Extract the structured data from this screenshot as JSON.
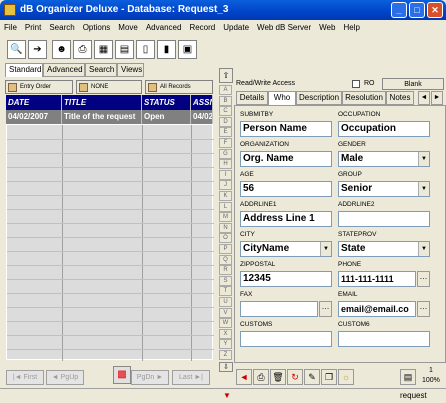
{
  "window": {
    "title": "dB Organizer Deluxe - Database: Request_3",
    "minimize": "_",
    "maximize": "□",
    "close": "✕"
  },
  "menu": [
    "File",
    "Print",
    "Search",
    "Options",
    "Move",
    "Advanced",
    "Record",
    "Update",
    "Web dB Server",
    "Web",
    "Help"
  ],
  "left_tabs": [
    "Standard",
    "Advanced",
    "Search",
    "Views"
  ],
  "left_toolbar": {
    "entry_order": "Entry Order",
    "none": "NONE",
    "all_records": "All Records"
  },
  "grid": {
    "columns": [
      "DATE",
      "TITLE",
      "STATUS",
      "ASSN"
    ],
    "rows": [
      [
        "04/02/2007",
        "Title of the request",
        "Open",
        "04/02/"
      ]
    ]
  },
  "nav": {
    "first": "|◄ First",
    "pgup": "◄ PgUp",
    "pgdn": "PgDn ►",
    "last": "Last ►|"
  },
  "letters": [
    "A",
    "B",
    "C",
    "D",
    "E",
    "F",
    "G",
    "H",
    "I",
    "J",
    "K",
    "L",
    "M",
    "N",
    "O",
    "P",
    "Q",
    "R",
    "S",
    "T",
    "U",
    "V",
    "W",
    "X",
    "Y",
    "Z"
  ],
  "right": {
    "access": "Read/Write Access",
    "ro": "RO",
    "blank": "Blank",
    "tabs": [
      "Details",
      "Who",
      "Description",
      "Resolution",
      "Notes"
    ]
  },
  "form": {
    "submitby_label": "SUBMITBY",
    "submitby": "Person Name",
    "occupation_label": "OCCUPATION",
    "occupation": "Occupation",
    "organization_label": "ORGANIZATION",
    "organization": "Org. Name",
    "gender_label": "GENDER",
    "gender": "Male",
    "age_label": "AGE",
    "age": "56",
    "group_label": "GROUP",
    "group": "Senior",
    "addrline1_label": "ADDRLINE1",
    "addrline1": "Address Line 1",
    "addrline2_label": "ADDRLINE2",
    "addrline2": "",
    "city_label": "CITY",
    "city": "CityName",
    "stateprov_label": "STATEPROV",
    "stateprov": "State",
    "zippostal_label": "ZIPPOSTAL",
    "zippostal": "12345",
    "phone_label": "PHONE",
    "phone": "111-111-1111",
    "fax_label": "FAX",
    "fax": "",
    "email_label": "EMAIL",
    "email": "email@email.co",
    "customs_label": "CUSTOMS",
    "customs": "",
    "custom6_label": "CUSTOM6",
    "custom6": ""
  },
  "status": {
    "count": "1",
    "zoom": "100%",
    "name": "request"
  }
}
